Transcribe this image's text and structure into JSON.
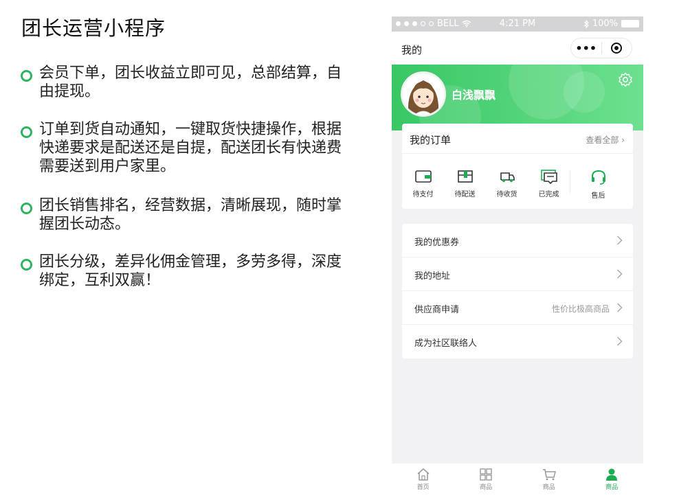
{
  "slide": {
    "title": "团长运营小程序",
    "bullets": [
      "会员下单，团长收益立即可见，总部结算，自由提现。",
      "订单到货自动通知，一键取货快捷操作，根据快递要求是配送还是自提，配送团长有快递费需要送到用户家里。",
      "团长销售排名，经营数据，清晰展现，随时掌握团长动态。",
      "团长分级，差异化佣金管理，多劳多得，深度绑定，互利双赢！"
    ]
  },
  "phone": {
    "statusbar": {
      "carrier": "BELL",
      "time": "4:21 PM",
      "battery": "100%"
    },
    "navbar": {
      "title": "我的",
      "more_icon": "more-dots-icon",
      "close_icon": "target-icon"
    },
    "profile": {
      "username": "白浅飘飘",
      "settings_icon": "gear-icon"
    },
    "orders": {
      "title": "我的订单",
      "view_all": "查看全部 ›",
      "items": [
        {
          "label": "待支付",
          "icon": "wallet-icon"
        },
        {
          "label": "待配送",
          "icon": "package-icon"
        },
        {
          "label": "待收货",
          "icon": "truck-icon"
        },
        {
          "label": "已完成",
          "icon": "message-icon"
        },
        {
          "label": "售后",
          "icon": "headset-icon"
        }
      ]
    },
    "menu": [
      {
        "label": "我的优惠券",
        "extra": ""
      },
      {
        "label": "我的地址",
        "extra": ""
      },
      {
        "label": "供应商申请",
        "extra": "性价比极高商品"
      },
      {
        "label": "成为社区联络人",
        "extra": ""
      }
    ],
    "tabbar": [
      {
        "label": "首页",
        "icon": "home-icon",
        "active": false
      },
      {
        "label": "商品",
        "icon": "grid-icon",
        "active": false
      },
      {
        "label": "商品",
        "icon": "cart-icon",
        "active": false
      },
      {
        "label": "商品",
        "icon": "user-icon",
        "active": true
      }
    ]
  },
  "colors": {
    "brand_green": "#38c764",
    "tab_active": "#1aad52",
    "bullet_ring": "#2eb35f"
  }
}
